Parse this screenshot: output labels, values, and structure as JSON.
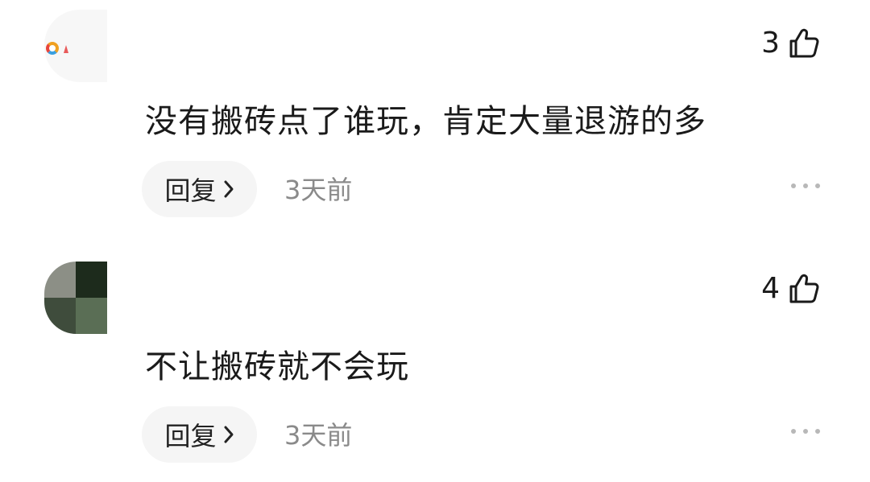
{
  "comments": [
    {
      "like_count": "3",
      "text": "没有搬砖点了谁玩，肯定大量退游的多",
      "reply_label": "回复",
      "timestamp": "3天前"
    },
    {
      "like_count": "4",
      "text": "不让搬砖就不会玩",
      "reply_label": "回复",
      "timestamp": "3天前"
    }
  ],
  "icons": {
    "like": "thumb-up-icon",
    "reply_arrow": "chevron-right-icon",
    "more": "more-horizontal-icon"
  },
  "colors": {
    "text": "#1a1a1a",
    "timestamp": "#8a8a8a",
    "reply_bg": "#f5f5f5",
    "more_dots": "#b8b8b8"
  }
}
